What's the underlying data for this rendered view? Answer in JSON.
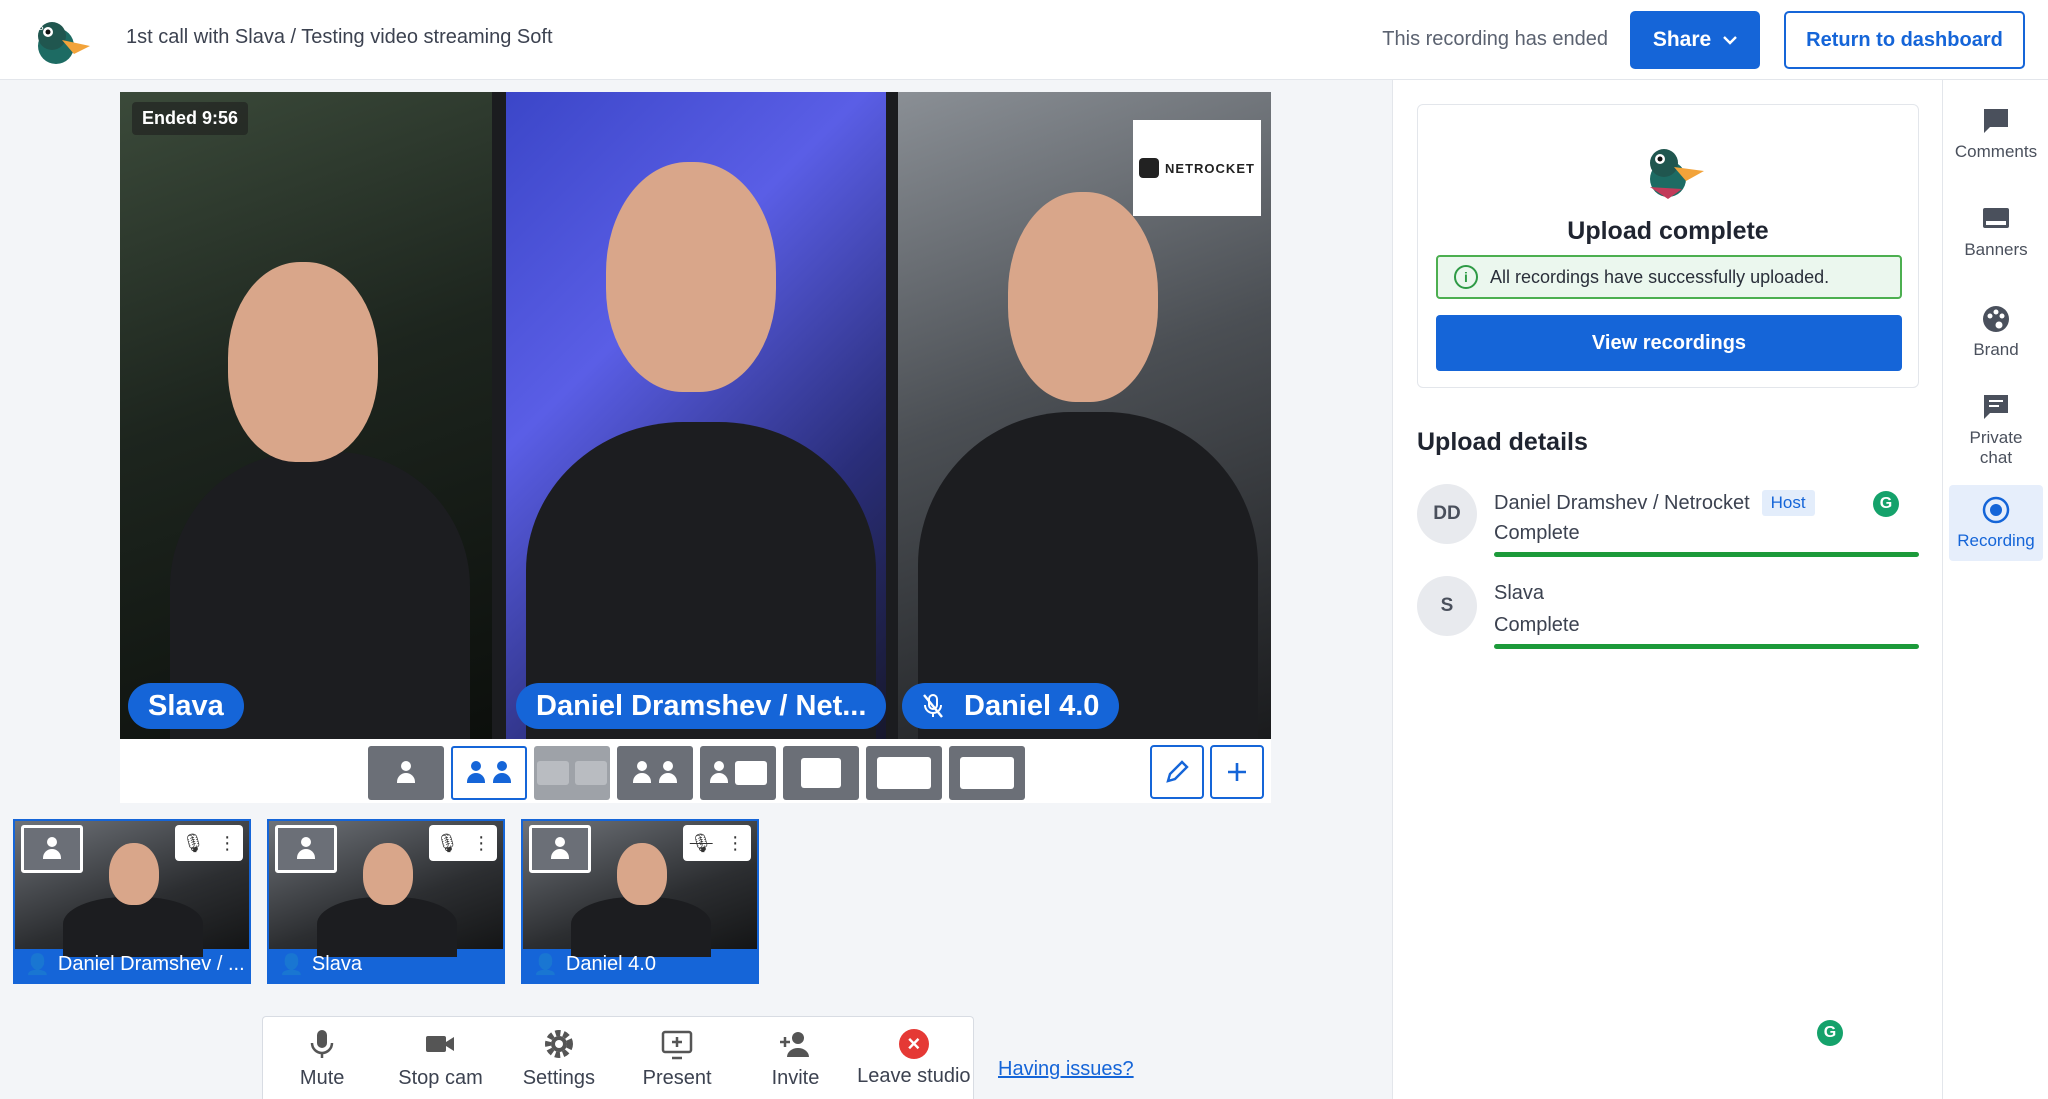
{
  "header": {
    "title": "1st call with Slava / Testing video streaming Soft",
    "recording_status": "This recording has ended",
    "share_label": "Share",
    "return_label": "Return to dashboard"
  },
  "stage": {
    "ended_badge": "Ended 9:56",
    "tiles": [
      {
        "name": "Slava",
        "muted": false
      },
      {
        "name": "Daniel Dramshev / Net...",
        "muted": false
      },
      {
        "name": "Daniel 4.0",
        "muted": true
      }
    ],
    "overlay_brand": "NETROCKET"
  },
  "thumbnails": [
    {
      "label": "Daniel Dramshev / ...",
      "muted": false
    },
    {
      "label": "Slava",
      "muted": false
    },
    {
      "label": "Daniel 4.0",
      "muted": true
    }
  ],
  "controls": [
    {
      "label": "Mute",
      "icon": "mic-icon"
    },
    {
      "label": "Stop cam",
      "icon": "camera-icon"
    },
    {
      "label": "Settings",
      "icon": "gear-icon"
    },
    {
      "label": "Present",
      "icon": "present-icon"
    },
    {
      "label": "Invite",
      "icon": "add-person-icon"
    },
    {
      "label": "Leave studio",
      "icon": "leave-icon"
    }
  ],
  "having_issues": "Having issues?",
  "upload": {
    "title": "Upload complete",
    "success_message": "All recordings have successfully uploaded.",
    "view_button": "View recordings",
    "details_title": "Upload details",
    "participants": [
      {
        "initials": "DD",
        "name": "Daniel Dramshev / Netrocket",
        "badge": "Host",
        "status": "Complete",
        "progress": 1.0
      },
      {
        "initials": "S",
        "name": "Slava",
        "badge": "",
        "status": "Complete",
        "progress": 1.0
      }
    ]
  },
  "rail": {
    "items": [
      {
        "label": "Comments",
        "icon": "comment-icon"
      },
      {
        "label": "Banners",
        "icon": "banner-icon"
      },
      {
        "label": "Brand",
        "icon": "palette-icon"
      },
      {
        "label": "Private chat",
        "icon": "chat-icon"
      },
      {
        "label": "Recording",
        "icon": "record-icon",
        "active": true
      }
    ]
  },
  "colors": {
    "accent": "#1565d8",
    "success": "#1c9a3a",
    "danger": "#e53935"
  }
}
